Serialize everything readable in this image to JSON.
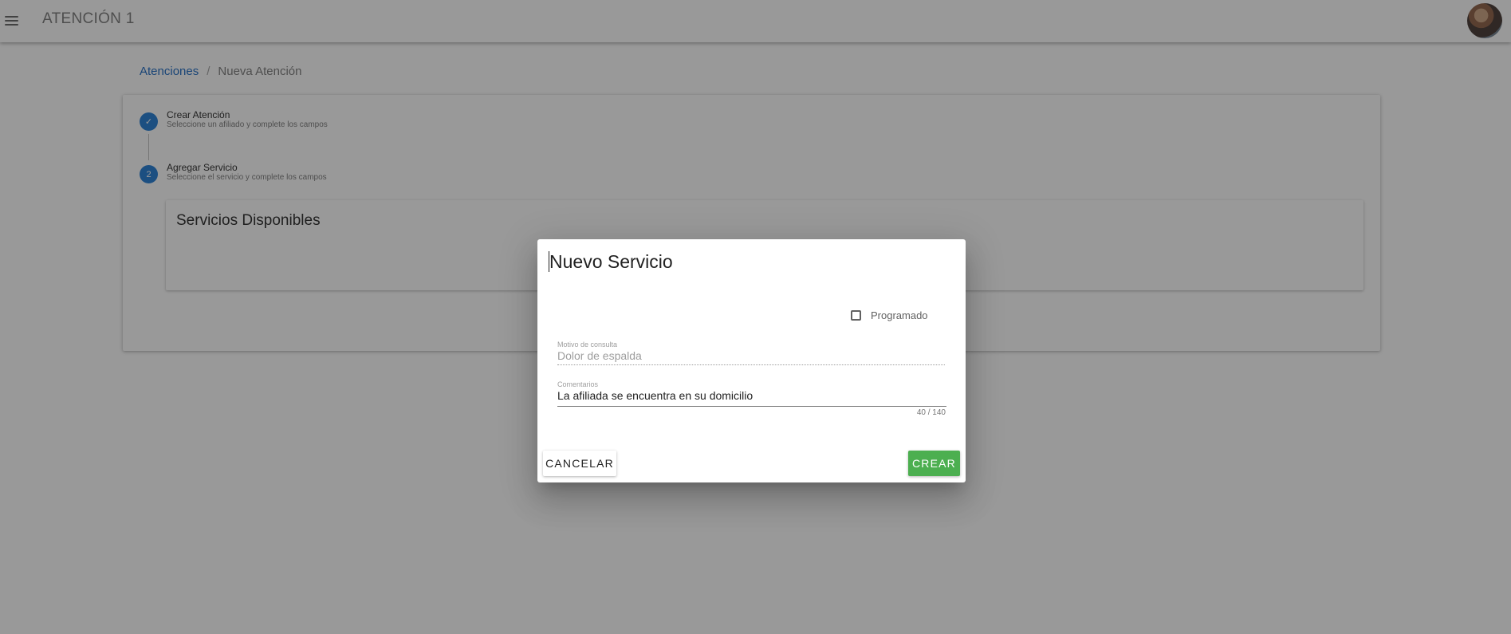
{
  "app": {
    "title": "ATENCIÓN 1",
    "menu_icon": "menu-icon",
    "avatar_icon": "user-avatar"
  },
  "breadcrumb": {
    "link": "Atenciones",
    "separator": "/",
    "current": "Nueva Atención"
  },
  "stepper": {
    "steps": [
      {
        "indicator": "✓",
        "title": "Crear Atención",
        "subtitle": "Seleccione un afiliado y complete los campos",
        "state": "completed"
      },
      {
        "indicator": "2",
        "title": "Agregar Servicio",
        "subtitle": "Seleccione el servicio y complete los campos",
        "state": "active"
      }
    ]
  },
  "services": {
    "title": "Servicios Disponibles"
  },
  "dialog": {
    "title": "Nuevo Servicio",
    "checkbox_label": "Programado",
    "checkbox_checked": false,
    "motivo": {
      "label": "Motivo de consulta",
      "value": "Dolor de espalda"
    },
    "comentarios": {
      "label": "Comentarios",
      "value": "La afiliada se encuentra en su domicilio",
      "counter": "40 / 140"
    },
    "cancel_label": "CANCELAR",
    "create_label": "CREAR"
  },
  "colors": {
    "primary": "#1976d2",
    "success": "#4caf50",
    "link": "#1565c0"
  }
}
